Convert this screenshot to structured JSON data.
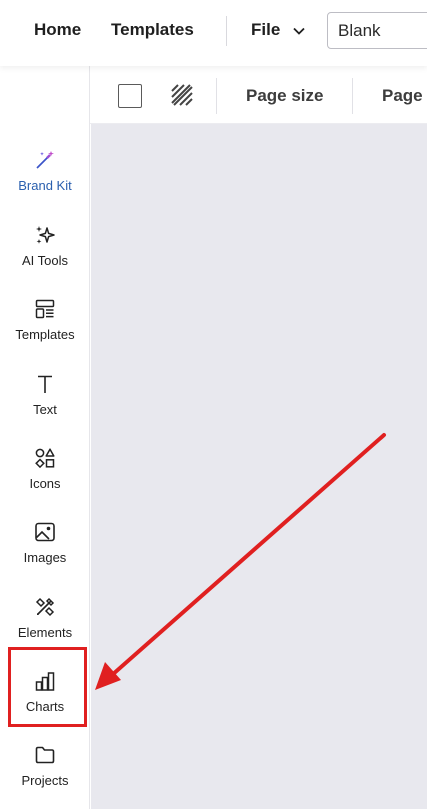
{
  "topbar": {
    "home": "Home",
    "templates": "Templates",
    "file": "File",
    "doc_name": "Blank"
  },
  "toolbar": {
    "page_size": "Page size",
    "page": "Page"
  },
  "sidebar": {
    "items": [
      {
        "label": "Brand Kit",
        "icon": "magic-wand-icon"
      },
      {
        "label": "AI Tools",
        "icon": "sparkles-icon"
      },
      {
        "label": "Templates",
        "icon": "templates-icon"
      },
      {
        "label": "Text",
        "icon": "text-icon"
      },
      {
        "label": "Icons",
        "icon": "shapes-icon"
      },
      {
        "label": "Images",
        "icon": "image-icon"
      },
      {
        "label": "Elements",
        "icon": "elements-icon"
      },
      {
        "label": "Charts",
        "icon": "bar-chart-icon"
      },
      {
        "label": "Projects",
        "icon": "folder-icon"
      }
    ]
  },
  "colors": {
    "accent": "#2a5fae",
    "annotation": "#e02020",
    "canvas": "#e8e8ee"
  }
}
